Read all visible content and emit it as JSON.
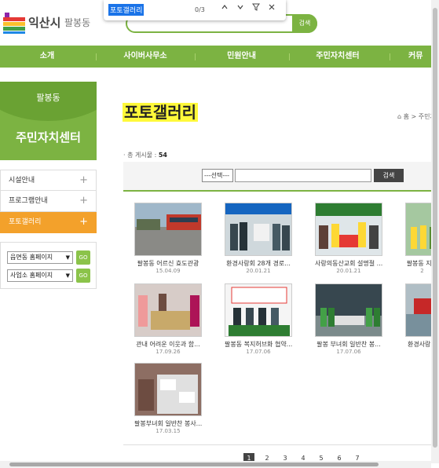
{
  "header": {
    "logo_text": "익산시",
    "logo_sub": "팔봉동",
    "search_button": "검색"
  },
  "findbar": {
    "query": "포토갤러리",
    "count": "0/3"
  },
  "nav": {
    "items": [
      "소개",
      "사이버사무소",
      "민원안내",
      "주민자치센터",
      "커뮤"
    ]
  },
  "sidebar": {
    "town": "팔봉동",
    "title": "주민자치센터",
    "items": [
      {
        "label": "시설안내",
        "plus": "+"
      },
      {
        "label": "프로그램안내",
        "plus": "+"
      },
      {
        "label": "포토갤러리",
        "plus": "+"
      }
    ],
    "selects": [
      {
        "value": "읍면동 홈페이지",
        "go": "GO"
      },
      {
        "value": "사업소 홈페이지",
        "go": "GO"
      }
    ]
  },
  "main": {
    "title": "포토갤러리",
    "breadcrumb": "홈 > 주민자",
    "count_label": "· 총 게시물 : ",
    "count_value": "54",
    "search_select": "---선택---",
    "search_button": "검색"
  },
  "gallery": [
    {
      "caption": "팔봉동 어르신 효도관광",
      "date": "15.04.09"
    },
    {
      "caption": "환경사랑회 28개 경로...",
      "date": "20.01.21"
    },
    {
      "caption": "사랑의동산교회 설명절 ...",
      "date": "20.01.21"
    },
    {
      "caption": "팔봉동 지...",
      "date": "2"
    },
    {
      "caption": "관내 어려운 이웃과 함...",
      "date": "17.09.26"
    },
    {
      "caption": "팔봉동 복지허브화 협약...",
      "date": "17.07.06"
    },
    {
      "caption": "팔봉 부녀회 일반찬 봉...",
      "date": "17.07.06"
    },
    {
      "caption": "환경사랑...",
      "date": ""
    },
    {
      "caption": "팔봉부녀회 일반찬 봉사...",
      "date": "17.03.15"
    }
  ],
  "pagination": [
    "1",
    "2",
    "3",
    "4",
    "5",
    "6",
    "7"
  ],
  "colors": {
    "accent_green": "#7cb342",
    "active_orange": "#f3a12b",
    "title_highlight": "#fff93a"
  }
}
